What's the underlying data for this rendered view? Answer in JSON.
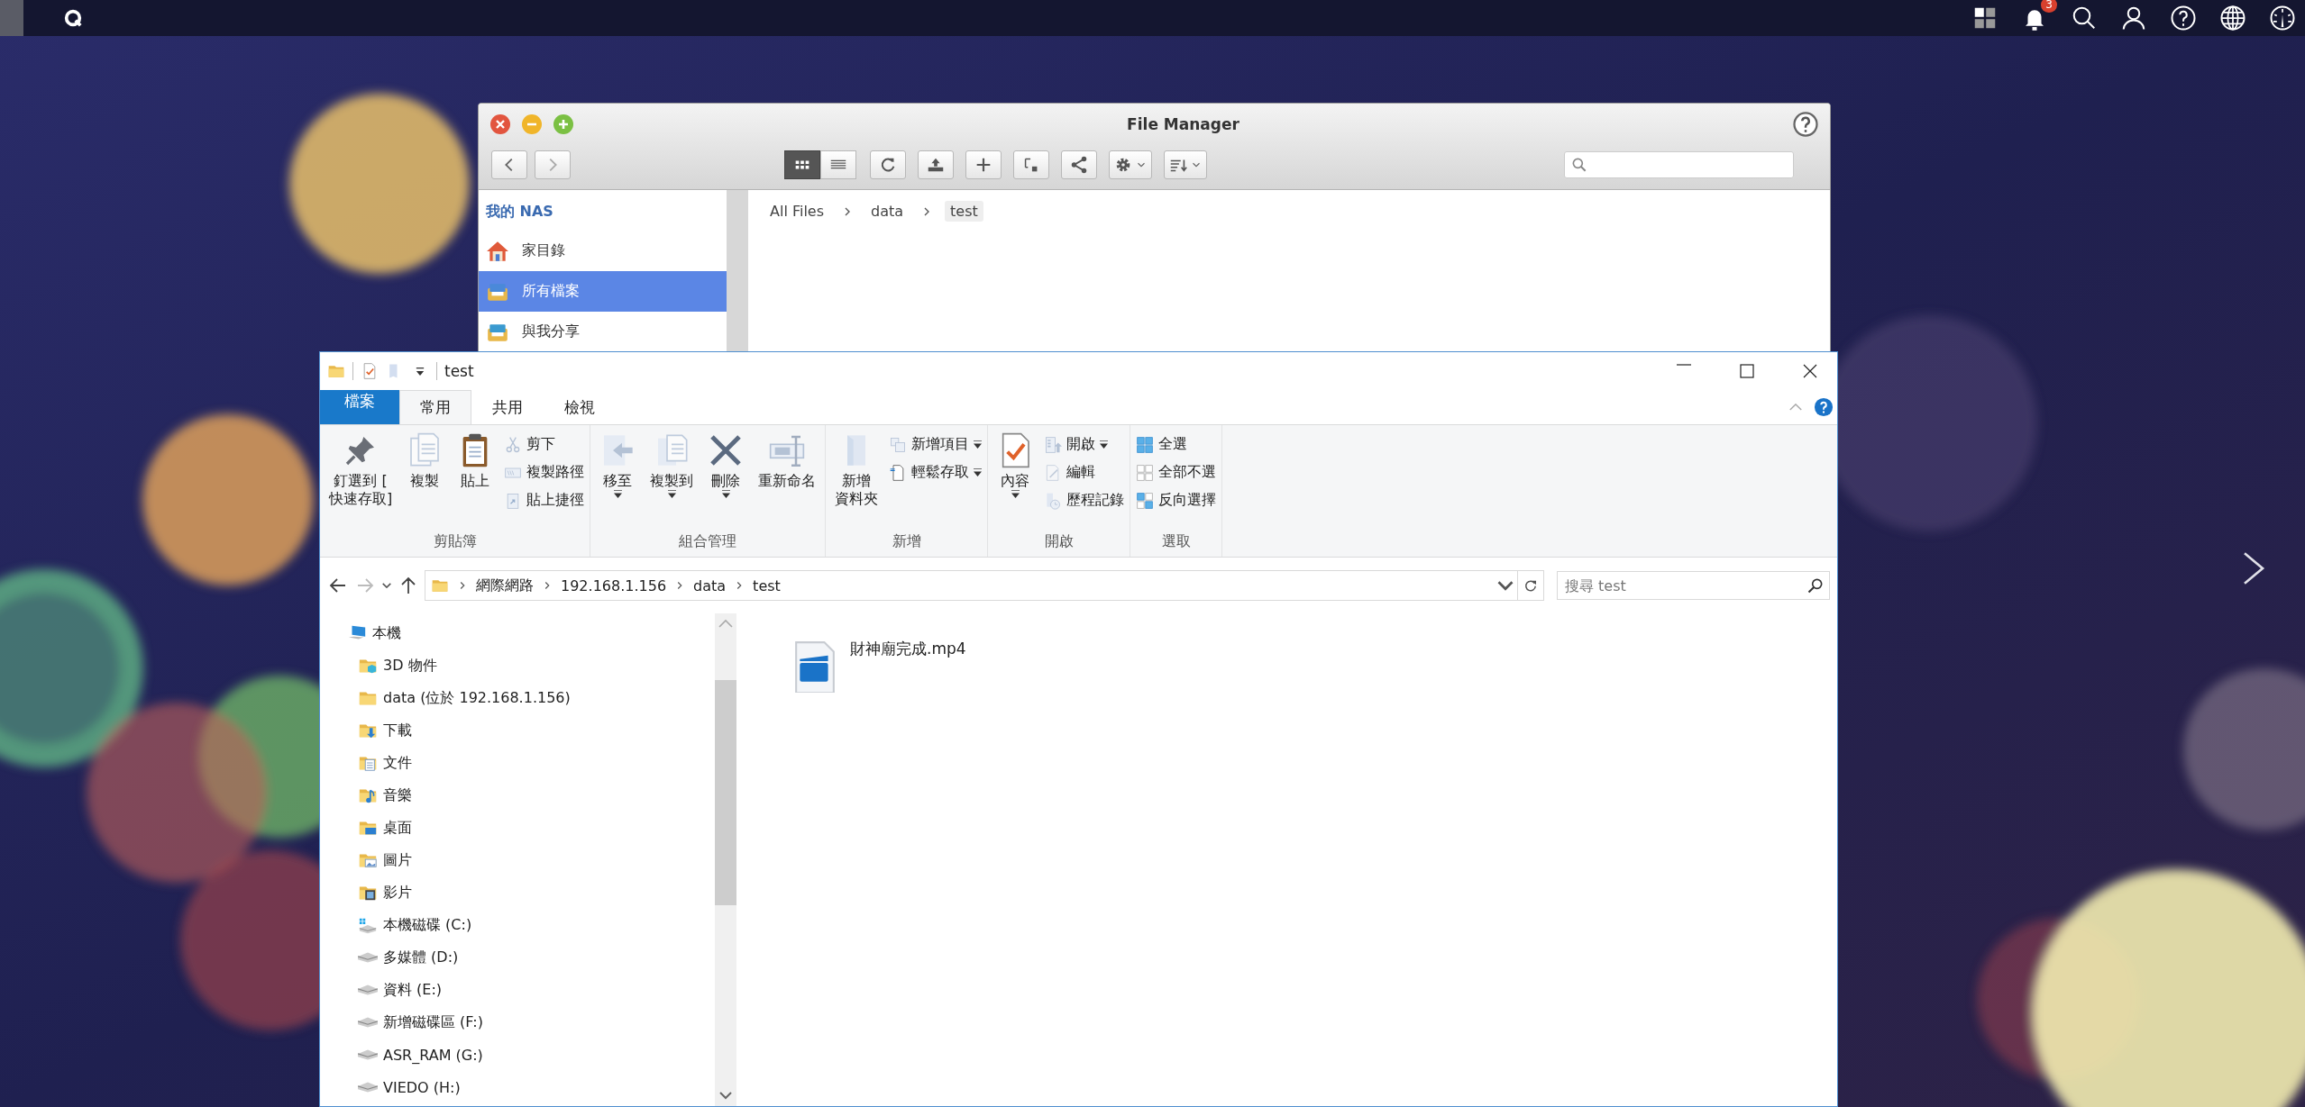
{
  "top_bar": {
    "notification_count": "3"
  },
  "file_manager": {
    "title": "File Manager",
    "view_modes": [
      {
        "selected": true
      },
      {
        "selected": false
      }
    ],
    "sidebar": {
      "heading": "我的 NAS",
      "items": [
        {
          "label": "家目錄",
          "selected": false
        },
        {
          "label": "所有檔案",
          "selected": true
        },
        {
          "label": "與我分享",
          "selected": false
        }
      ]
    },
    "breadcrumb": [
      {
        "label": "All Files",
        "selected": false
      },
      {
        "label": "data",
        "selected": false
      },
      {
        "label": "test",
        "selected": true
      }
    ]
  },
  "explorer": {
    "title": "test",
    "tabs": [
      {
        "label": "檔案",
        "kind": "file-menu",
        "selected": false
      },
      {
        "label": "常用",
        "kind": "tab",
        "selected": true
      },
      {
        "label": "共用",
        "kind": "tab",
        "selected": false
      },
      {
        "label": "檢視",
        "kind": "tab",
        "selected": false
      }
    ],
    "ribbon_groups": [
      {
        "label": "剪貼簿",
        "items": [
          {
            "lines": [
              "釘選到 [",
              "快速存取]"
            ],
            "kind": "large",
            "disabled": false,
            "dropdown": false
          },
          {
            "label": "複製",
            "kind": "large",
            "disabled": true,
            "dropdown": false
          },
          {
            "label": "貼上",
            "kind": "large",
            "disabled": false,
            "dropdown": false
          },
          {
            "label": "剪下",
            "kind": "small",
            "disabled": true,
            "dropdown": false
          },
          {
            "label": "複製路徑",
            "kind": "small",
            "disabled": true,
            "dropdown": false
          },
          {
            "label": "貼上捷徑",
            "kind": "small",
            "disabled": true,
            "dropdown": false
          }
        ]
      },
      {
        "label": "組合管理",
        "items": [
          {
            "label": "移至",
            "kind": "large",
            "disabled": true,
            "dropdown": true
          },
          {
            "label": "複製到",
            "kind": "large",
            "disabled": true,
            "dropdown": true
          },
          {
            "label": "刪除",
            "kind": "large",
            "disabled": false,
            "dropdown": true
          },
          {
            "label": "重新命名",
            "kind": "large",
            "disabled": true,
            "dropdown": false
          }
        ]
      },
      {
        "label": "新增",
        "items": [
          {
            "lines": [
              "新增",
              "資料夾"
            ],
            "kind": "large",
            "disabled": true,
            "dropdown": false
          },
          {
            "label": "新增項目",
            "kind": "small",
            "disabled": true,
            "dropdown": true
          },
          {
            "label": "輕鬆存取",
            "kind": "small",
            "disabled": false,
            "dropdown": true
          }
        ]
      },
      {
        "label": "開啟",
        "items": [
          {
            "label": "內容",
            "kind": "large",
            "disabled": false,
            "dropdown": true
          },
          {
            "label": "開啟",
            "kind": "small",
            "disabled": true,
            "dropdown": true
          },
          {
            "label": "編輯",
            "kind": "small",
            "disabled": true,
            "dropdown": false
          },
          {
            "label": "歷程記錄",
            "kind": "small",
            "disabled": true,
            "dropdown": false
          }
        ]
      },
      {
        "label": "選取",
        "items": [
          {
            "label": "全選",
            "kind": "small",
            "disabled": false,
            "dropdown": false
          },
          {
            "label": "全部不選",
            "kind": "small",
            "disabled": false,
            "dropdown": false
          },
          {
            "label": "反向選擇",
            "kind": "small",
            "disabled": false,
            "dropdown": false
          }
        ]
      }
    ],
    "address": [
      "網際網路",
      "192.168.1.156",
      "data",
      "test"
    ],
    "search": {
      "placeholder": "搜尋 test"
    },
    "nav_tree": [
      {
        "label": "本機",
        "children": [
          {
            "label": "3D 物件"
          },
          {
            "label": "data (位於 192.168.1.156)"
          },
          {
            "label": "下載"
          },
          {
            "label": "文件"
          },
          {
            "label": "音樂"
          },
          {
            "label": "桌面"
          },
          {
            "label": "圖片"
          },
          {
            "label": "影片"
          },
          {
            "label": "本機磁碟 (C:)"
          },
          {
            "label": "多媒體 (D:)"
          },
          {
            "label": "資料 (E:)"
          },
          {
            "label": "新增磁碟區 (F:)"
          },
          {
            "label": "ASR_RAM (G:)"
          },
          {
            "label": "VIEDO (H:)"
          }
        ]
      }
    ],
    "files": [
      {
        "name": "財神廟完成.mp4"
      }
    ]
  }
}
